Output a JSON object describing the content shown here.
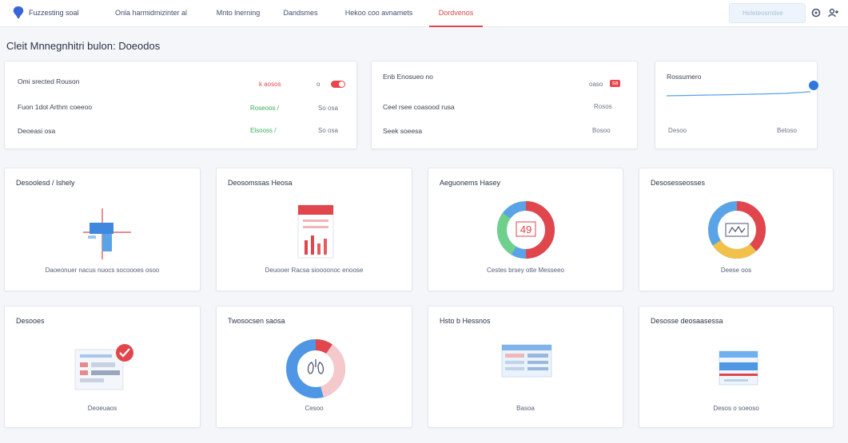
{
  "topbar": {
    "brand": "Fuzzesting soal",
    "nav": [
      {
        "label": "Onla harmidmizinter al"
      },
      {
        "label": "Mnto lnerning"
      },
      {
        "label": "Dandsmes"
      },
      {
        "label": "Hekoo coo avnamets"
      },
      {
        "label": "Dordvenos"
      }
    ],
    "active_index": 4,
    "search_placeholder": "Heleteosmtive",
    "accent": "#e0464c"
  },
  "page": {
    "title": "Cleit Mnnegnhitri bulon: Doeodos"
  },
  "summary": {
    "card1": {
      "rows": [
        {
          "label": "Omi srected Rouson",
          "value": "k aosos",
          "tone": "red",
          "action": "o"
        },
        {
          "label": "Fuon 1dot Arthm coeeoo",
          "value": "Roseoos /",
          "tone": "green",
          "action": "So osa"
        },
        {
          "label": "Deoeasi osa",
          "value": "Elsooss /",
          "tone": "green",
          "action": "So osa"
        }
      ]
    },
    "card2": {
      "rows": [
        {
          "label": "Enb Enosueo no",
          "value": "oaso",
          "tag": "sa"
        },
        {
          "label": "Ceel rsee coasood rusa",
          "value": "Rosos"
        },
        {
          "label": "Seek soeesa",
          "value": "Bosoo"
        }
      ]
    },
    "card3": {
      "title": "Rossumero",
      "foot_left": "Desoo",
      "foot_right": "Betoso"
    }
  },
  "widgets": [
    {
      "title": "Desoolesd / Ishely",
      "caption": "Daoeonuer nacus nuocs socoooes osoo",
      "icon": "crosshair-chart-icon"
    },
    {
      "title": "Deosomssas Heosa",
      "caption": "Deuooer Racsa sioooonoc enoose",
      "icon": "calendar-bars-icon"
    },
    {
      "title": "Aeguonems Hasey",
      "caption": "Cestes brsey otte Messeeo",
      "icon": "donut-chart-icon",
      "center": "49"
    },
    {
      "title": "Desosesseosses",
      "caption": "Deese oos",
      "icon": "donut-chart-icon"
    },
    {
      "title": "Desooes",
      "caption": "Deoeuaos",
      "icon": "checklist-icon"
    },
    {
      "title": "Twosocsen saosa",
      "caption": "Cesoo",
      "icon": "lungs-donut-icon"
    },
    {
      "title": "Hsto b Hessnos",
      "caption": "Basoa",
      "icon": "table-screen-icon"
    },
    {
      "title": "Desosse deosaasessa",
      "caption": "Desos o soeoso",
      "icon": "document-stack-icon"
    }
  ]
}
